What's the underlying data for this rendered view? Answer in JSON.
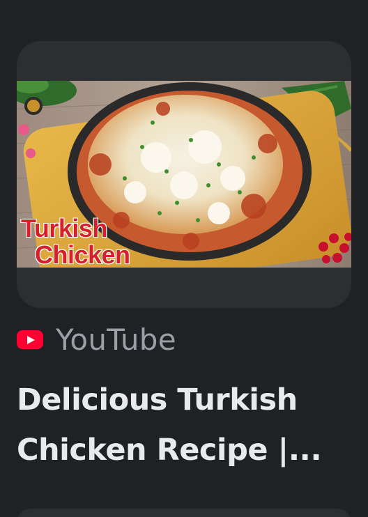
{
  "result_card": {
    "thumbnail": {
      "overlay_line_1": "Turkish",
      "overlay_line_2": "Chicken",
      "overlay_color": "#d6202a"
    },
    "source": {
      "icon": "youtube-icon",
      "icon_color": "#ff0033",
      "name": "YouTube"
    },
    "title": "Delicious Turkish Chicken Recipe |..."
  },
  "colors": {
    "background": "#202124",
    "card": "#2d2e31",
    "title_text": "#e8eaed",
    "source_text": "#9aa0a6"
  }
}
